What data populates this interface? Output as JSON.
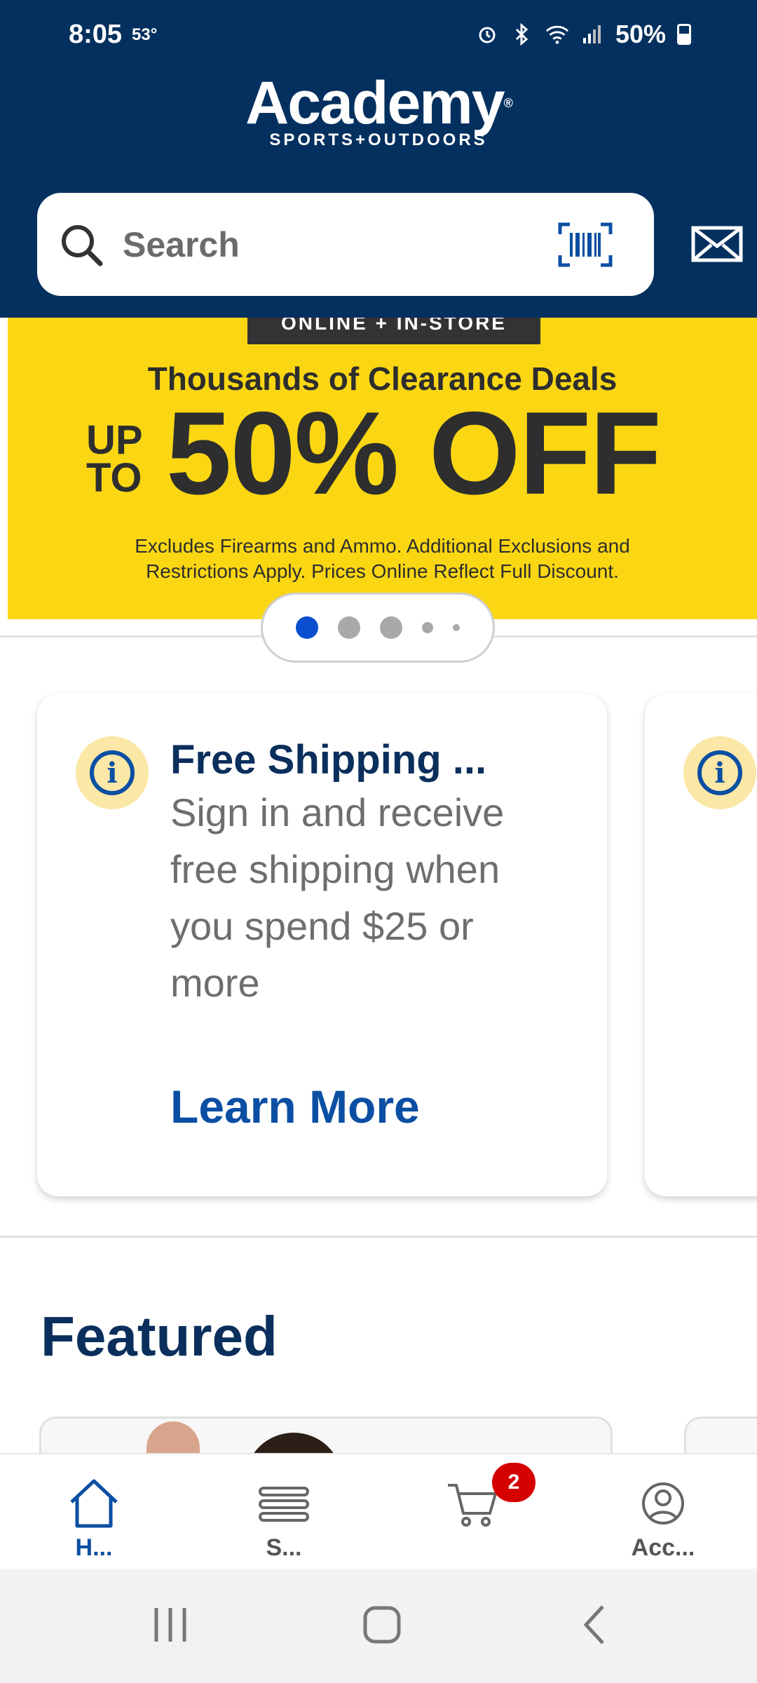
{
  "status_bar": {
    "time": "8:05",
    "temperature": "53°",
    "battery": "50%"
  },
  "header": {
    "logo_main": "Academy",
    "logo_sub": "SPORTS+OUTDOORS",
    "search_placeholder": "Search"
  },
  "banner": {
    "tag": "ONLINE + IN-STORE",
    "heading": "Thousands of Clearance Deals",
    "upto_line1": "UP",
    "upto_line2": "TO",
    "big": "50% OFF",
    "fine_line1": "Excludes Firearms and Ammo. Additional Exclusions and",
    "fine_line2": "Restrictions Apply. Prices Online Reflect Full Discount.",
    "slide_count": 5,
    "active_slide": 1
  },
  "info_card": {
    "title": "Free Shipping ...",
    "body": "Sign in and receive free shipping when you spend $25 or more",
    "link": "Learn More"
  },
  "featured": {
    "title": "Featured"
  },
  "bottom_nav": {
    "items": [
      {
        "label": "H...",
        "icon": "home-icon",
        "active": true
      },
      {
        "label": "S...",
        "icon": "menu-icon",
        "active": false
      },
      {
        "label": "",
        "icon": "cart-icon",
        "active": false
      },
      {
        "label": "Acc...",
        "icon": "account-icon",
        "active": false
      }
    ],
    "cart_count": "2"
  },
  "colors": {
    "navy": "#04305f",
    "banner_yellow": "#fbd713",
    "link_blue": "#0a4fa3",
    "badge_red": "#d50000"
  }
}
